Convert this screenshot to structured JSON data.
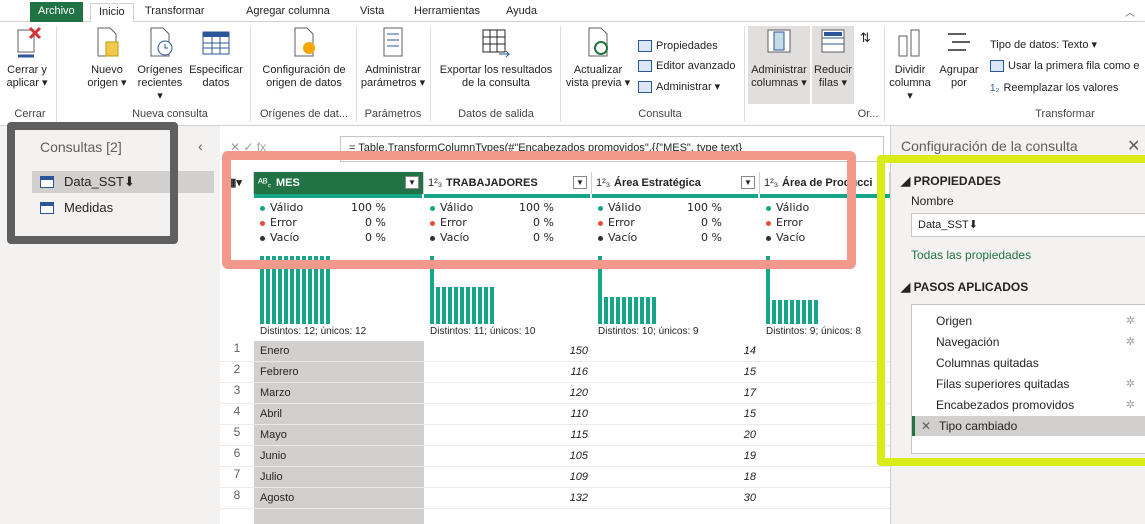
{
  "tabs": [
    "Archivo",
    "Inicio",
    "Transformar",
    "Agregar columna",
    "Vista",
    "Herramientas",
    "Ayuda"
  ],
  "ribbon": {
    "buttons": [
      {
        "label1": "Cerrar y",
        "label2": "aplicar ▾"
      },
      {
        "label1": "Nuevo",
        "label2": "origen ▾"
      },
      {
        "label1": "Orígenes",
        "label2": "recientes ▾"
      },
      {
        "label1": "Especificar",
        "label2": "datos"
      },
      {
        "label1": "Configuración de",
        "label2": "origen de datos"
      },
      {
        "label1": "Administrar",
        "label2": "parámetros ▾"
      },
      {
        "label1": "Exportar los resultados",
        "label2": "de la consulta"
      },
      {
        "label1": "Actualizar",
        "label2": "vista previa ▾"
      },
      {
        "label1": "Administrar",
        "label2": "columnas ▾"
      },
      {
        "label1": "Reducir",
        "label2": "filas ▾"
      },
      {
        "label1": "Dividir",
        "label2": "columna ▾"
      },
      {
        "label1": "Agrupar",
        "label2": "por"
      }
    ],
    "small": {
      "propiedades": "Propiedades",
      "editor": "Editor avanzado",
      "administrar": "Administrar ▾",
      "tipo": "Tipo de datos: Texto ▾",
      "primera": "Usar la primera fila como e",
      "reemplazar": "Reemplazar los valores"
    },
    "groups": [
      "Cerrar",
      "Nueva consulta",
      "Orígenes de dat...",
      "Parámetros",
      "Datos de salida",
      "Consulta",
      "Or...",
      "Transformar"
    ]
  },
  "queries": {
    "title": "Consultas [2]",
    "items": [
      "Data_SST⬇",
      "Medidas"
    ]
  },
  "formula": "= Table.TransformColumnTypes(#\"Encabezados promovidos\",{{\"MES\", type text}",
  "columns": [
    {
      "type": "A B C",
      "name": "MES",
      "valid": "100 %",
      "error": "0 %",
      "empty": "0 %",
      "dist": "Distintos: 12; únicos: 12"
    },
    {
      "type": "1 2 3",
      "name": "TRABAJADORES",
      "valid": "100 %",
      "error": "0 %",
      "empty": "0 %",
      "dist": "Distintos: 11; únicos: 10"
    },
    {
      "type": "1 2 3",
      "name": "Área Estratégica",
      "valid": "100 %",
      "error": "0 %",
      "empty": "0 %",
      "dist": "Distintos: 10; únicos: 9"
    },
    {
      "type": "1 2 3",
      "name": "Área de Producci",
      "valid": "",
      "error": "",
      "empty": "",
      "dist": "Distintos: 9; únicos: 8"
    }
  ],
  "stat_labels": {
    "valid": "Válido",
    "error": "Error",
    "empty": "Vacío"
  },
  "colors": {
    "valid": "#17a589",
    "error": "#e74c3c",
    "empty": "#323130",
    "accent": "#217346"
  },
  "rows": [
    {
      "n": "1",
      "mes": "Enero",
      "trab": "150",
      "area": "14"
    },
    {
      "n": "2",
      "mes": "Febrero",
      "trab": "116",
      "area": "15"
    },
    {
      "n": "3",
      "mes": "Marzo",
      "trab": "120",
      "area": "17"
    },
    {
      "n": "4",
      "mes": "Abril",
      "trab": "110",
      "area": "15"
    },
    {
      "n": "5",
      "mes": "Mayo",
      "trab": "115",
      "area": "20"
    },
    {
      "n": "6",
      "mes": "Junio",
      "trab": "105",
      "area": "19"
    },
    {
      "n": "7",
      "mes": "Julio",
      "trab": "109",
      "area": "18"
    },
    {
      "n": "8",
      "mes": "Agosto",
      "trab": "132",
      "area": "30"
    }
  ],
  "settings": {
    "title": "Configuración de la consulta",
    "props_header": "PROPIEDADES",
    "name_label": "Nombre",
    "name_value": "Data_SST⬇",
    "all_props": "Todas las propiedades",
    "steps_header": "PASOS APLICADOS",
    "steps": [
      {
        "label": "Origen",
        "gear": true
      },
      {
        "label": "Navegación",
        "gear": true
      },
      {
        "label": "Columnas quitadas",
        "gear": false
      },
      {
        "label": "Filas superiores quitadas",
        "gear": true
      },
      {
        "label": "Encabezados promovidos",
        "gear": true
      },
      {
        "label": "Tipo cambiado",
        "gear": false
      }
    ]
  }
}
